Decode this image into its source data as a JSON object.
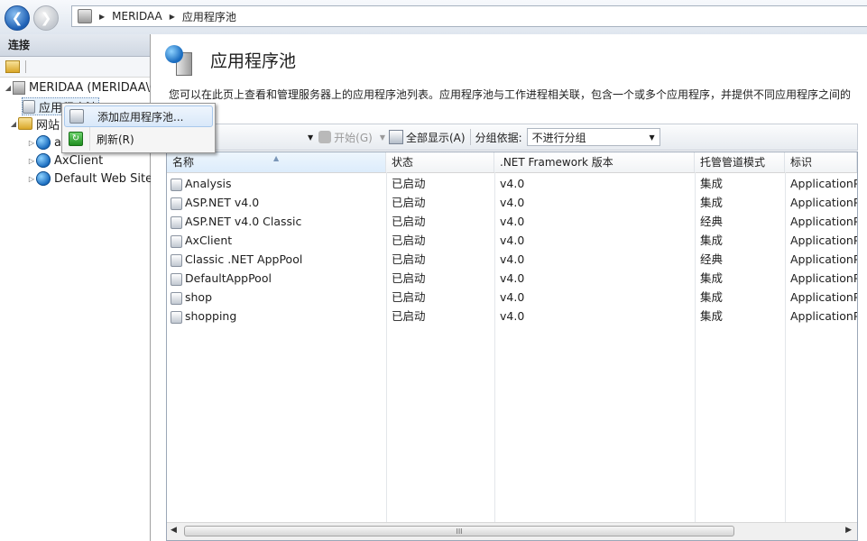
{
  "address_bar": {
    "crumbs": [
      "MERIDAA",
      "应用程序池"
    ]
  },
  "connections": {
    "title": "连接",
    "tree": [
      {
        "label": "MERIDAA (MERIDAA\\Oa",
        "icon": "server-icon",
        "level": 0,
        "expander": "collapse"
      },
      {
        "label": "应用程序池",
        "icon": "app-pool-icon",
        "level": 1,
        "selected": true
      },
      {
        "label": "网站",
        "icon": "folder-icon",
        "level": 1,
        "expander": "collapse"
      },
      {
        "label": "a",
        "icon": "globe-icon",
        "level": 2,
        "expander": "expand"
      },
      {
        "label": "AxClient",
        "icon": "globe-icon",
        "level": 2,
        "expander": "expand"
      },
      {
        "label": "Default Web Site",
        "icon": "globe-icon",
        "level": 2,
        "expander": "expand"
      }
    ]
  },
  "context_menu": {
    "items": [
      {
        "label": "添加应用程序池...",
        "icon": "add-app-pool-icon",
        "highlighted": true
      },
      {
        "label": "刷新(R)",
        "icon": "refresh-icon",
        "highlighted": false
      }
    ]
  },
  "main": {
    "title": "应用程序池",
    "description": "您可以在此页上查看和管理服务器上的应用程序池列表。应用程序池与工作进程相关联，包含一个或多个应用程序，并提供不同应用程序之间的",
    "filter": {
      "start_label": "开始(G)",
      "show_all_label": "全部显示(A)",
      "group_by_label": "分组依据:",
      "group_by_value": "不进行分组"
    },
    "columns": [
      "名称",
      "状态",
      ".NET Framework 版本",
      "托管管道模式",
      "标识"
    ],
    "rows": [
      [
        "Analysis",
        "已启动",
        "v4.0",
        "集成",
        "ApplicationP"
      ],
      [
        "ASP.NET v4.0",
        "已启动",
        "v4.0",
        "集成",
        "ApplicationP"
      ],
      [
        "ASP.NET v4.0 Classic",
        "已启动",
        "v4.0",
        "经典",
        "ApplicationP"
      ],
      [
        "AxClient",
        "已启动",
        "v4.0",
        "集成",
        "ApplicationP"
      ],
      [
        "Classic .NET AppPool",
        "已启动",
        "v4.0",
        "经典",
        "ApplicationP"
      ],
      [
        "DefaultAppPool",
        "已启动",
        "v4.0",
        "集成",
        "ApplicationP"
      ],
      [
        "shop",
        "已启动",
        "v4.0",
        "集成",
        "ApplicationP"
      ],
      [
        "shopping",
        "已启动",
        "v4.0",
        "集成",
        "ApplicationP"
      ]
    ],
    "scrollbar_grip": "III"
  }
}
